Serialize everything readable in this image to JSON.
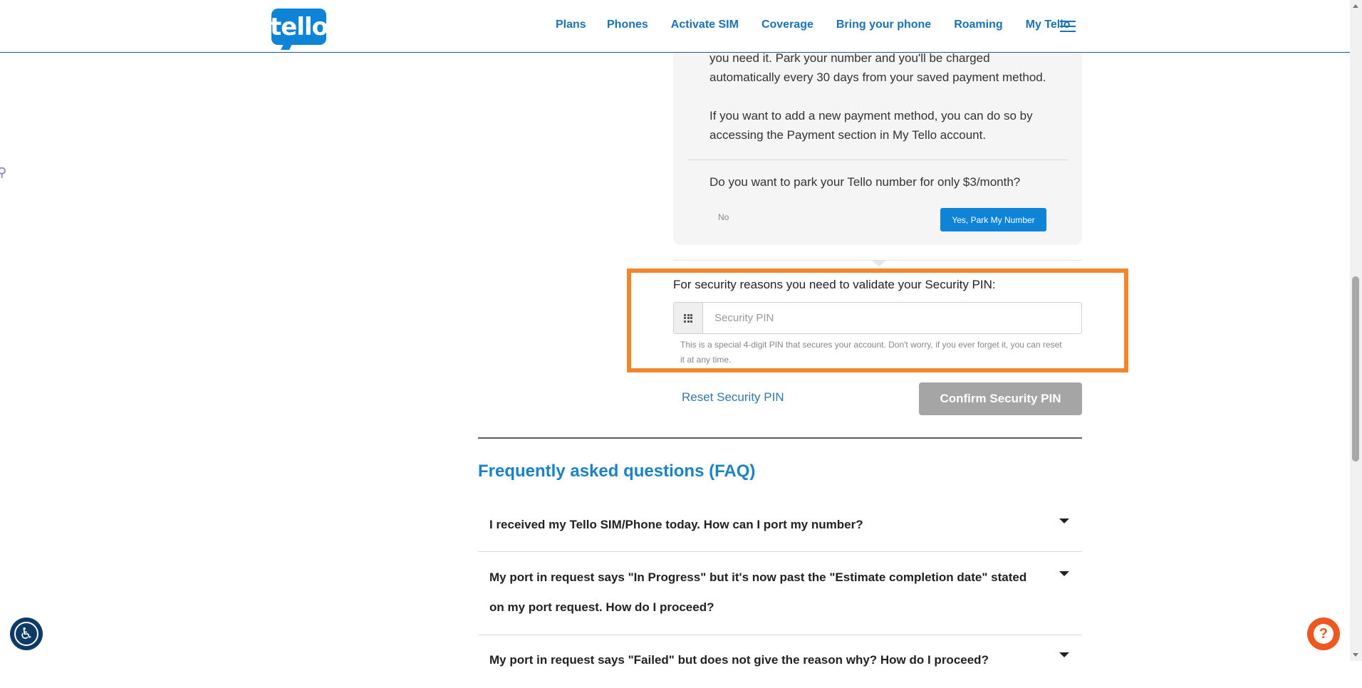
{
  "header": {
    "logo_text": "tello",
    "nav": [
      "Plans",
      "Phones",
      "Activate SIM",
      "Coverage",
      "Bring your phone",
      "Roaming",
      "My Tello"
    ],
    "menu_icon": "hamburger-icon"
  },
  "park_card": {
    "paragraph1": "you need it. Park your number and you'll be charged automatically every 30 days from your saved payment method.",
    "paragraph2": "If you want to add a new payment method, you can do so by accessing the Payment section in My Tello account.",
    "question": "Do you want to park your Tello number for only $3/month?",
    "no_label": "No",
    "yes_label": "Yes, Park My Number"
  },
  "security": {
    "label": "For security reasons you need to validate your Security PIN:",
    "placeholder": "Security PIN",
    "value": "",
    "help_text": "This is a special 4-digit PIN that secures your account. Don't worry, if you ever forget it, you can reset it at any time.",
    "reset_label": "Reset Security PIN",
    "confirm_label": "Confirm Security PIN",
    "highlight_color": "#f5852b"
  },
  "faq": {
    "title": "Frequently asked questions (FAQ)",
    "items": [
      "I received my Tello SIM/Phone today. How can I port my number?",
      "My port in request says \"In Progress\" but it's now past the \"Estimate completion date\" stated on my port request. How do I proceed?",
      "My port in request says \"Failed\" but does not give the reason why? How do I proceed?"
    ]
  },
  "colors": {
    "brand_blue": "#0e84d8",
    "link_blue": "#1a72b8",
    "help_orange": "#f0561f",
    "disabled_gray": "#a5a5a5"
  }
}
